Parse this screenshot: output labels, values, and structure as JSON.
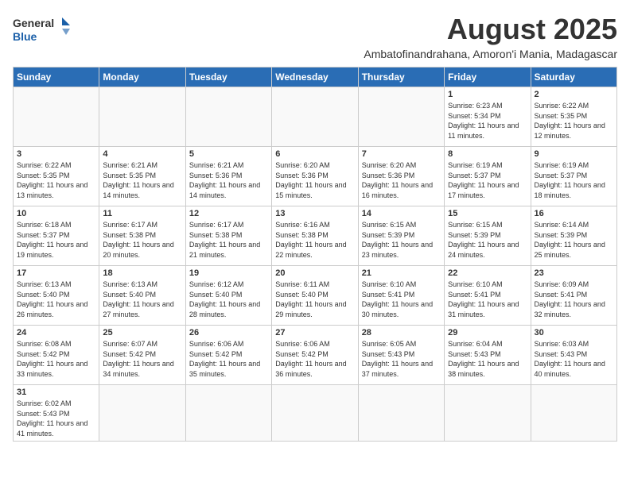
{
  "header": {
    "logo_general": "General",
    "logo_blue": "Blue",
    "main_title": "August 2025",
    "subtitle": "Ambatofinandrahana, Amoron'i Mania, Madagascar"
  },
  "days_of_week": [
    "Sunday",
    "Monday",
    "Tuesday",
    "Wednesday",
    "Thursday",
    "Friday",
    "Saturday"
  ],
  "weeks": [
    [
      {
        "day": "",
        "info": ""
      },
      {
        "day": "",
        "info": ""
      },
      {
        "day": "",
        "info": ""
      },
      {
        "day": "",
        "info": ""
      },
      {
        "day": "",
        "info": ""
      },
      {
        "day": "1",
        "info": "Sunrise: 6:23 AM\nSunset: 5:34 PM\nDaylight: 11 hours and 11 minutes."
      },
      {
        "day": "2",
        "info": "Sunrise: 6:22 AM\nSunset: 5:35 PM\nDaylight: 11 hours and 12 minutes."
      }
    ],
    [
      {
        "day": "3",
        "info": "Sunrise: 6:22 AM\nSunset: 5:35 PM\nDaylight: 11 hours and 13 minutes."
      },
      {
        "day": "4",
        "info": "Sunrise: 6:21 AM\nSunset: 5:35 PM\nDaylight: 11 hours and 14 minutes."
      },
      {
        "day": "5",
        "info": "Sunrise: 6:21 AM\nSunset: 5:36 PM\nDaylight: 11 hours and 14 minutes."
      },
      {
        "day": "6",
        "info": "Sunrise: 6:20 AM\nSunset: 5:36 PM\nDaylight: 11 hours and 15 minutes."
      },
      {
        "day": "7",
        "info": "Sunrise: 6:20 AM\nSunset: 5:36 PM\nDaylight: 11 hours and 16 minutes."
      },
      {
        "day": "8",
        "info": "Sunrise: 6:19 AM\nSunset: 5:37 PM\nDaylight: 11 hours and 17 minutes."
      },
      {
        "day": "9",
        "info": "Sunrise: 6:19 AM\nSunset: 5:37 PM\nDaylight: 11 hours and 18 minutes."
      }
    ],
    [
      {
        "day": "10",
        "info": "Sunrise: 6:18 AM\nSunset: 5:37 PM\nDaylight: 11 hours and 19 minutes."
      },
      {
        "day": "11",
        "info": "Sunrise: 6:17 AM\nSunset: 5:38 PM\nDaylight: 11 hours and 20 minutes."
      },
      {
        "day": "12",
        "info": "Sunrise: 6:17 AM\nSunset: 5:38 PM\nDaylight: 11 hours and 21 minutes."
      },
      {
        "day": "13",
        "info": "Sunrise: 6:16 AM\nSunset: 5:38 PM\nDaylight: 11 hours and 22 minutes."
      },
      {
        "day": "14",
        "info": "Sunrise: 6:15 AM\nSunset: 5:39 PM\nDaylight: 11 hours and 23 minutes."
      },
      {
        "day": "15",
        "info": "Sunrise: 6:15 AM\nSunset: 5:39 PM\nDaylight: 11 hours and 24 minutes."
      },
      {
        "day": "16",
        "info": "Sunrise: 6:14 AM\nSunset: 5:39 PM\nDaylight: 11 hours and 25 minutes."
      }
    ],
    [
      {
        "day": "17",
        "info": "Sunrise: 6:13 AM\nSunset: 5:40 PM\nDaylight: 11 hours and 26 minutes."
      },
      {
        "day": "18",
        "info": "Sunrise: 6:13 AM\nSunset: 5:40 PM\nDaylight: 11 hours and 27 minutes."
      },
      {
        "day": "19",
        "info": "Sunrise: 6:12 AM\nSunset: 5:40 PM\nDaylight: 11 hours and 28 minutes."
      },
      {
        "day": "20",
        "info": "Sunrise: 6:11 AM\nSunset: 5:40 PM\nDaylight: 11 hours and 29 minutes."
      },
      {
        "day": "21",
        "info": "Sunrise: 6:10 AM\nSunset: 5:41 PM\nDaylight: 11 hours and 30 minutes."
      },
      {
        "day": "22",
        "info": "Sunrise: 6:10 AM\nSunset: 5:41 PM\nDaylight: 11 hours and 31 minutes."
      },
      {
        "day": "23",
        "info": "Sunrise: 6:09 AM\nSunset: 5:41 PM\nDaylight: 11 hours and 32 minutes."
      }
    ],
    [
      {
        "day": "24",
        "info": "Sunrise: 6:08 AM\nSunset: 5:42 PM\nDaylight: 11 hours and 33 minutes."
      },
      {
        "day": "25",
        "info": "Sunrise: 6:07 AM\nSunset: 5:42 PM\nDaylight: 11 hours and 34 minutes."
      },
      {
        "day": "26",
        "info": "Sunrise: 6:06 AM\nSunset: 5:42 PM\nDaylight: 11 hours and 35 minutes."
      },
      {
        "day": "27",
        "info": "Sunrise: 6:06 AM\nSunset: 5:42 PM\nDaylight: 11 hours and 36 minutes."
      },
      {
        "day": "28",
        "info": "Sunrise: 6:05 AM\nSunset: 5:43 PM\nDaylight: 11 hours and 37 minutes."
      },
      {
        "day": "29",
        "info": "Sunrise: 6:04 AM\nSunset: 5:43 PM\nDaylight: 11 hours and 38 minutes."
      },
      {
        "day": "30",
        "info": "Sunrise: 6:03 AM\nSunset: 5:43 PM\nDaylight: 11 hours and 40 minutes."
      }
    ],
    [
      {
        "day": "31",
        "info": "Sunrise: 6:02 AM\nSunset: 5:43 PM\nDaylight: 11 hours and 41 minutes."
      },
      {
        "day": "",
        "info": ""
      },
      {
        "day": "",
        "info": ""
      },
      {
        "day": "",
        "info": ""
      },
      {
        "day": "",
        "info": ""
      },
      {
        "day": "",
        "info": ""
      },
      {
        "day": "",
        "info": ""
      }
    ]
  ]
}
